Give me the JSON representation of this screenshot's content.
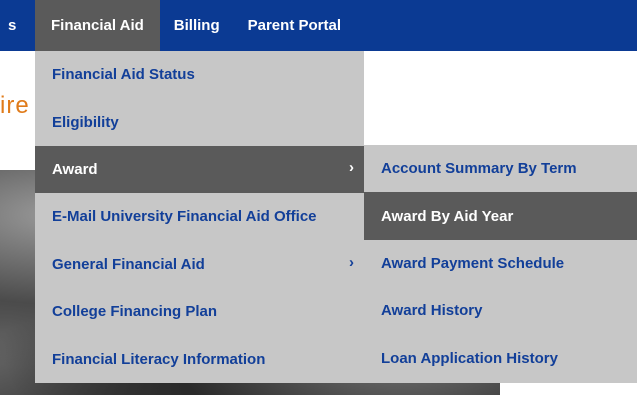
{
  "topnav": {
    "items": [
      {
        "label": "s"
      },
      {
        "label": "Financial Aid"
      },
      {
        "label": "Billing"
      },
      {
        "label": "Parent Portal"
      }
    ]
  },
  "background": {
    "partial_heading": "ire"
  },
  "financial_aid_menu": {
    "items": [
      {
        "label": "Financial Aid Status"
      },
      {
        "label": "Eligibility"
      },
      {
        "label": "Award",
        "chevron": "›"
      },
      {
        "label": "E-Mail University Financial Aid Office"
      },
      {
        "label": "General Financial Aid",
        "chevron": "›"
      },
      {
        "label": "College Financing Plan"
      },
      {
        "label": "Financial Literacy Information"
      }
    ]
  },
  "award_submenu": {
    "items": [
      {
        "label": "Account Summary By Term"
      },
      {
        "label": "Award By Aid Year"
      },
      {
        "label": "Award Payment Schedule"
      },
      {
        "label": "Award History"
      },
      {
        "label": "Loan Application History"
      }
    ]
  },
  "colors": {
    "nav_bg": "#0b3a93",
    "menu_bg": "#c7c7c7",
    "active_bg": "#5a5a5a",
    "link_text": "#123f99",
    "accent_orange": "#e07b1a"
  }
}
